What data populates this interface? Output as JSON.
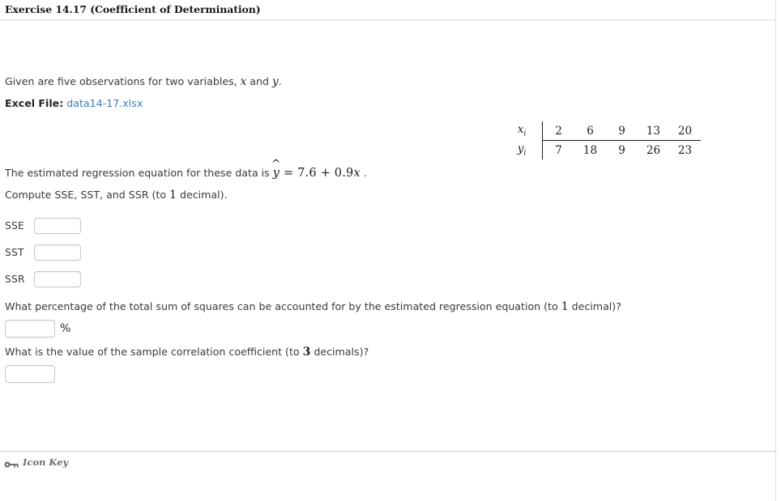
{
  "header": {
    "title": "Exercise 14.17 (Coefficient of Determination)"
  },
  "intro": {
    "prefix": "Given are five observations for two variables, ",
    "var_x": "x",
    "middle": " and ",
    "var_y": "y",
    "suffix": "."
  },
  "excel": {
    "label": "Excel File:",
    "filename": "data14-17.xlsx"
  },
  "data_table": {
    "x_label": "x",
    "x_subscript": "i",
    "y_label": "y",
    "y_subscript": "i",
    "x_values": [
      "2",
      "6",
      "9",
      "13",
      "20"
    ],
    "y_values": [
      "7",
      "18",
      "9",
      "26",
      "23"
    ]
  },
  "regression": {
    "prefix": "The estimated regression equation for these data is ",
    "hat": "^",
    "yvar": "y",
    "equals": " = ",
    "intercept": "7.6",
    "plus": " + ",
    "slope": "0.9",
    "xvar": "x",
    "period": " ."
  },
  "compute_line": {
    "prefix": "Compute SSE, SST, and SSR (to ",
    "precision": "1",
    "suffix": " decimal)."
  },
  "answers": [
    {
      "label": "SSE",
      "value": "",
      "placeholder": ""
    },
    {
      "label": "SST",
      "value": "",
      "placeholder": ""
    },
    {
      "label": "SSR",
      "value": "",
      "placeholder": ""
    }
  ],
  "question_percent": {
    "prefix": "What percentage of the total sum of squares can be accounted for by the estimated regression equation (to ",
    "precision": "1",
    "suffix": " decimal)?",
    "input_value": "",
    "unit": "%"
  },
  "question_correlation": {
    "prefix": "What is the value of the sample correlation coefficient (to ",
    "precision": "3",
    "suffix": " decimals)?",
    "input_value": ""
  },
  "footer": {
    "icon_key_label": "Icon Key"
  },
  "colors": {
    "link": "#3b7dbd",
    "text": "#3a3a3a",
    "rule": "#cfcfcf",
    "input_border": "#c8c8c8"
  }
}
